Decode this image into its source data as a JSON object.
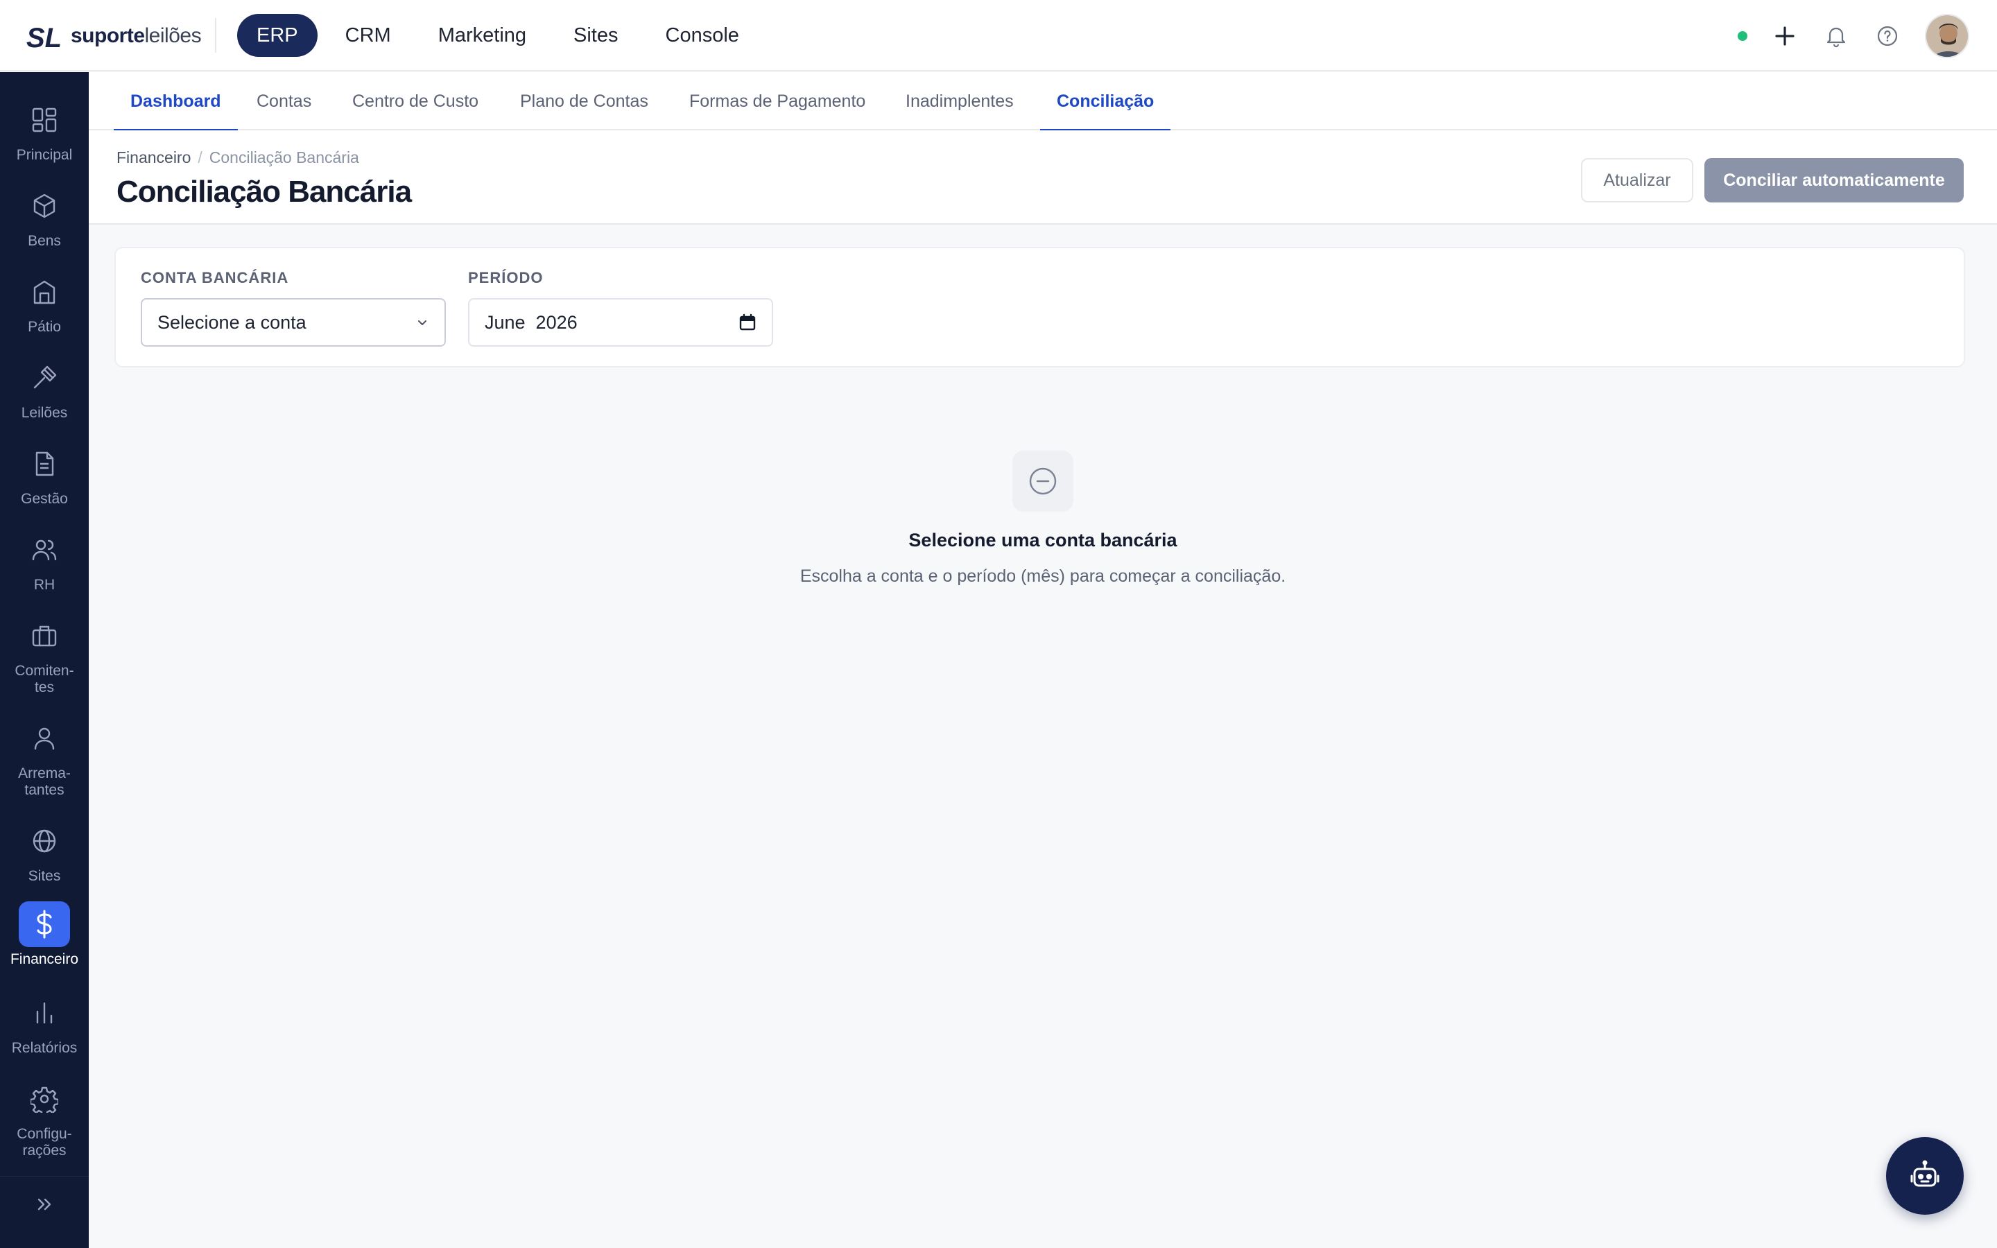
{
  "brand": {
    "name_bold": "suporte",
    "name_light": "leilões",
    "mark": "SL"
  },
  "top_nav": [
    "ERP",
    "CRM",
    "Marketing",
    "Sites",
    "Console"
  ],
  "top_nav_active": "ERP",
  "top_icons": [
    "status-online",
    "plus-icon",
    "bell-icon",
    "help-icon",
    "user-avatar"
  ],
  "sidebar": {
    "items": [
      {
        "label": "Principal",
        "icon": "grid-icon"
      },
      {
        "label": "Bens",
        "icon": "box-icon"
      },
      {
        "label": "Pátio",
        "icon": "building-icon"
      },
      {
        "label": "Leilões",
        "icon": "gavel-icon"
      },
      {
        "label": "Gestão",
        "icon": "document-icon"
      },
      {
        "label": "RH",
        "icon": "users-icon"
      },
      {
        "label": "Comiten-\ntes",
        "icon": "briefcase-icon"
      },
      {
        "label": "Arrema-\ntantes",
        "icon": "user-icon"
      },
      {
        "label": "Sites",
        "icon": "globe-icon"
      },
      {
        "label": "Financeiro",
        "icon": "dollar-icon"
      },
      {
        "label": "Relatórios",
        "icon": "bar-chart-icon"
      },
      {
        "label": "Configu-\nrações",
        "icon": "gear-icon"
      }
    ],
    "active": "Financeiro"
  },
  "sub_tabs": [
    "Dashboard",
    "Contas",
    "Centro de Custo",
    "Plano de Contas",
    "Formas de Pagamento",
    "Inadimplentes",
    "Conciliação"
  ],
  "header": {
    "breadcrumb": [
      "Financeiro",
      "Conciliação Bancária"
    ],
    "breadcrumb_sep": "/",
    "title": "Conciliação Bancária",
    "refresh_label": "Atualizar",
    "auto_label": "Conciliar automaticamente"
  },
  "filters": {
    "account_label": "CONTA BANCÁRIA",
    "account_value": "Selecione a conta",
    "period_label": "PERÍODO",
    "period_value": "June  2026"
  },
  "empty_state": {
    "title": "Selecione uma conta bancária",
    "subtitle": "Escolha a conta e o período (mês) para começar a conciliação."
  },
  "colors": {
    "primary": "#1e48c4",
    "nav_active": "#1a2a5a",
    "sidebar_bg": "#111a35",
    "sidebar_active": "#3a67f0",
    "status_online": "#1fbf7a"
  }
}
